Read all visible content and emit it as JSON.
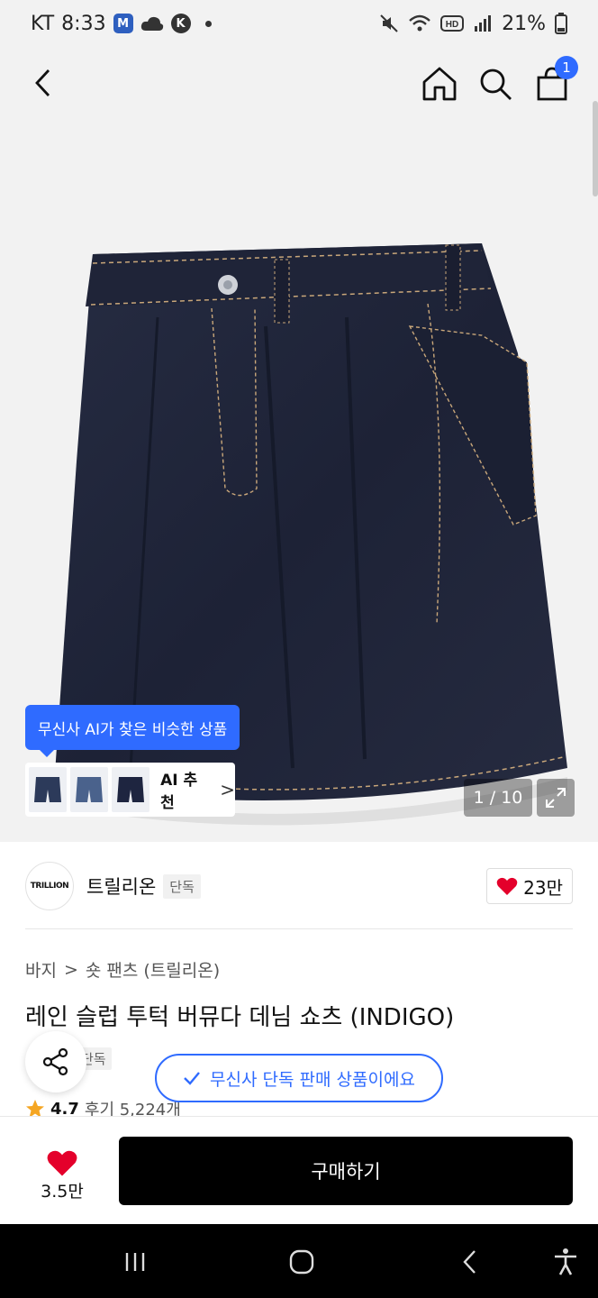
{
  "status_bar": {
    "carrier": "KT",
    "time": "8:33",
    "battery": "21%",
    "icons": [
      "notification-app-icon",
      "cloud-icon",
      "kakao-icon",
      "mute-icon",
      "wifi-icon",
      "hd-icon",
      "signal-icon",
      "battery-icon"
    ]
  },
  "nav": {
    "cart_count": "1",
    "icons": [
      "back-arrow-icon",
      "home-icon",
      "search-icon",
      "shopping-bag-icon"
    ]
  },
  "gallery": {
    "page_indicator": "1 / 10",
    "ai_tooltip": "무신사 AI가 찾은 비슷한 상품",
    "ai_label": "AI 추천",
    "ai_arrow": ">"
  },
  "brand": {
    "logo_text": "TRILLION",
    "name": "트릴리온",
    "exclusive_tag": "단독",
    "likes": "23만"
  },
  "product": {
    "breadcrumb_category": "바지",
    "breadcrumb_separator": ">",
    "breadcrumb_subcategory": "숏 팬츠 (트릴리온)",
    "title": "레인 슬럽 투턱 버뮤다 데님 쇼츠 (INDIGO)",
    "exclusive_small": "단독",
    "rating": "4.7",
    "reviews": "후기 5,224개"
  },
  "banner": {
    "exclusive_notice": "무신사 단독 판매 상품이에요"
  },
  "bottom": {
    "wish_count": "3.5만",
    "buy_label": "구매하기"
  },
  "colors": {
    "accent_blue": "#2f6bff",
    "heart_red": "#e4002b",
    "denim": "#20253a",
    "buy_button": "#000000"
  }
}
